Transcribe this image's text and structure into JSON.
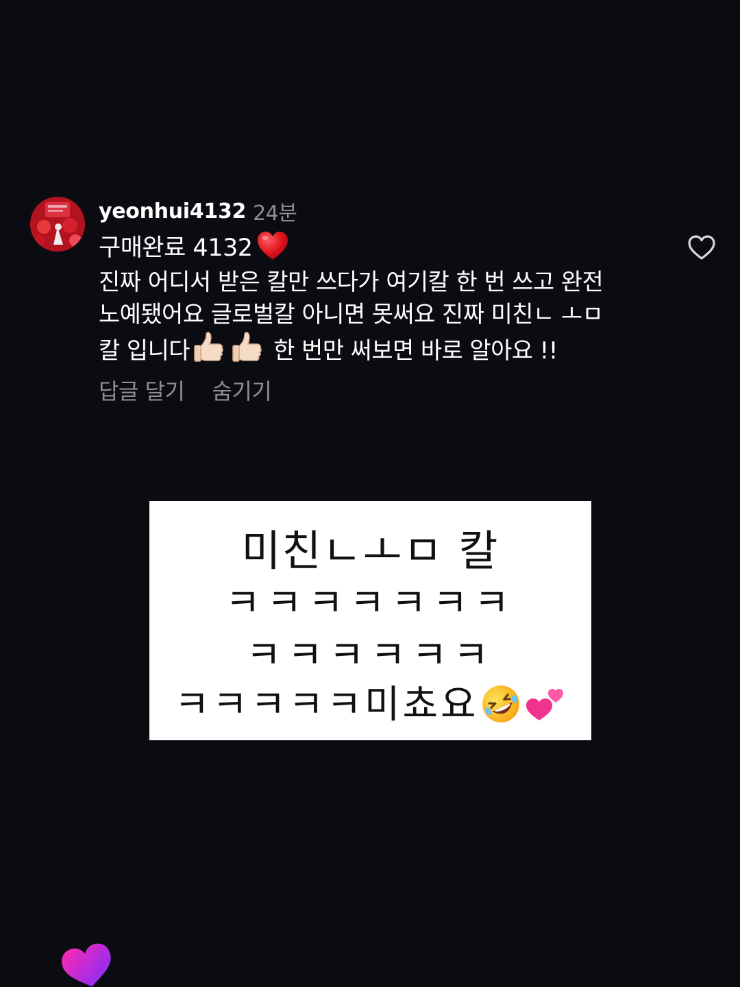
{
  "comment": {
    "username": "yeonhui4132",
    "time_ago": "24분",
    "headline": "구매완료 4132",
    "body_lines": [
      "진짜 어디서 받은 칼만 쓰다가 여기칼 한 번 쓰고 완전",
      "노예됐어요 글로벌칼 아니면 못써요 진짜 미친ㄴ ㅗㅁ",
      "칼 입니다",
      " 한 번만 써보면 바로 알아요 !!"
    ],
    "actions": {
      "reply": "답글 달기",
      "hide": "숨기기"
    }
  },
  "card": {
    "lines": [
      "미친ㄴㅗㅁ 칼",
      "ㅋㅋㅋㅋㅋㅋㅋ",
      "ㅋㅋㅋㅋㅋㅋ",
      "ㅋㅋㅋㅋㅋ미쵸요"
    ]
  },
  "icons": {
    "like": "heart-outline-icon",
    "headline_emoji": "red-heart-emoji",
    "thumbs": "thumbs-up-emoji",
    "laugh": "rolling-on-floor-laughing-emoji",
    "hearts": "two-hearts-emoji",
    "floating": "floating-heart-icon"
  },
  "colors": {
    "background": "#0b0c12",
    "muted_text": "#8e8f95",
    "card_background": "#ffffff",
    "heart_red": "#e0141e",
    "floating_heart_start": "#ff2bb0",
    "floating_heart_end": "#7a2cff"
  }
}
